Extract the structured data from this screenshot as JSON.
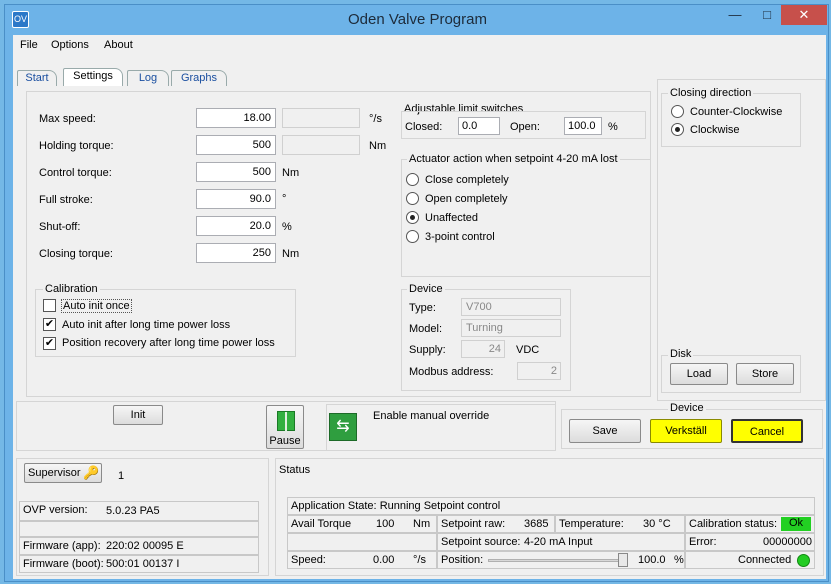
{
  "window": {
    "title": "Oden Valve Program",
    "minimize": "—",
    "maximize": "□",
    "close": "✕"
  },
  "menu": [
    "File",
    "Options",
    "About"
  ],
  "tabs": [
    "Start",
    "Settings",
    "Log",
    "Graphs"
  ],
  "settings": {
    "max_speed": {
      "label": "Max speed:",
      "value": "18.00",
      "unit": "°/s"
    },
    "holding_torque": {
      "label": "Holding torque:",
      "value": "500",
      "unit": "Nm"
    },
    "control_torque": {
      "label": "Control torque:",
      "value": "500",
      "unit": "Nm"
    },
    "full_stroke": {
      "label": "Full stroke:",
      "value": "90.0",
      "unit": "°"
    },
    "shut_off": {
      "label": "Shut-off:",
      "value": "20.0",
      "unit": "%"
    },
    "closing_torque": {
      "label": "Closing torque:",
      "value": "250",
      "unit": "Nm"
    }
  },
  "limit_switches": {
    "title": "Adjustable limit switches",
    "closed_label": "Closed:",
    "closed_value": "0.0",
    "open_label": "Open:",
    "open_value": "100.0",
    "unit": "%"
  },
  "actuator_action": {
    "title": "Actuator action when setpoint 4-20 mA lost",
    "options": [
      "Close completely",
      "Open completely",
      "Unaffected",
      "3-point control"
    ],
    "selected": "Unaffected"
  },
  "closing_direction": {
    "title": "Closing direction",
    "options": [
      "Counter-Clockwise",
      "Clockwise"
    ],
    "selected": "Clockwise"
  },
  "calibration": {
    "title": "Calibration",
    "items": [
      {
        "label": "Auto init once",
        "checked": false
      },
      {
        "label": "Auto init after long time power loss",
        "checked": true
      },
      {
        "label": "Position recovery after long time power loss",
        "checked": true
      }
    ]
  },
  "device_info": {
    "title": "Device",
    "type_label": "Type:",
    "type_value": "V700",
    "model_label": "Model:",
    "model_value": "Turning",
    "supply_label": "Supply:",
    "supply_value": "24",
    "supply_unit": "VDC",
    "modbus_label": "Modbus address:",
    "modbus_value": "2"
  },
  "disk": {
    "title": "Disk",
    "load": "Load",
    "store": "Store"
  },
  "controls": {
    "init": "Init",
    "pause": "Pause",
    "manual_override": "Enable manual override"
  },
  "device_actions": {
    "title": "Device",
    "save": "Save",
    "verkstall": "Verkställ",
    "cancel": "Cancel"
  },
  "supervisor": {
    "label": "Supervisor",
    "value": "1"
  },
  "versions": {
    "ovp_label": "OVP version:",
    "ovp_value": "5.0.23 PA5",
    "fw_app_label": "Firmware (app):",
    "fw_app_value": "220:02 00095 E",
    "fw_boot_label": "Firmware (boot):",
    "fw_boot_value": "500:01 00137 I"
  },
  "status": {
    "title": "Status",
    "app_state_label": "Application State:",
    "app_state_value": "Running Setpoint control",
    "avail_torque_label": "Avail Torque",
    "avail_torque_value": "100",
    "avail_torque_unit": "Nm",
    "setpoint_raw_label": "Setpoint raw:",
    "setpoint_raw_value": "3685",
    "temperature_label": "Temperature:",
    "temperature_value": "30 °C",
    "calibration_label": "Calibration status:",
    "calibration_value": "Ok",
    "setpoint_source_label": "Setpoint source:",
    "setpoint_source_value": "4-20 mA Input",
    "error_label": "Error:",
    "error_value": "00000000",
    "speed_label": "Speed:",
    "speed_value": "0.00",
    "speed_unit": "°/s",
    "position_label": "Position:",
    "position_value": "100.0",
    "position_unit": "%",
    "position_fraction": 1.0,
    "connected_label": "Connected"
  },
  "colors": {
    "ok": "#22d022",
    "yellow": "#ffff00",
    "connected": "#22cc22"
  }
}
